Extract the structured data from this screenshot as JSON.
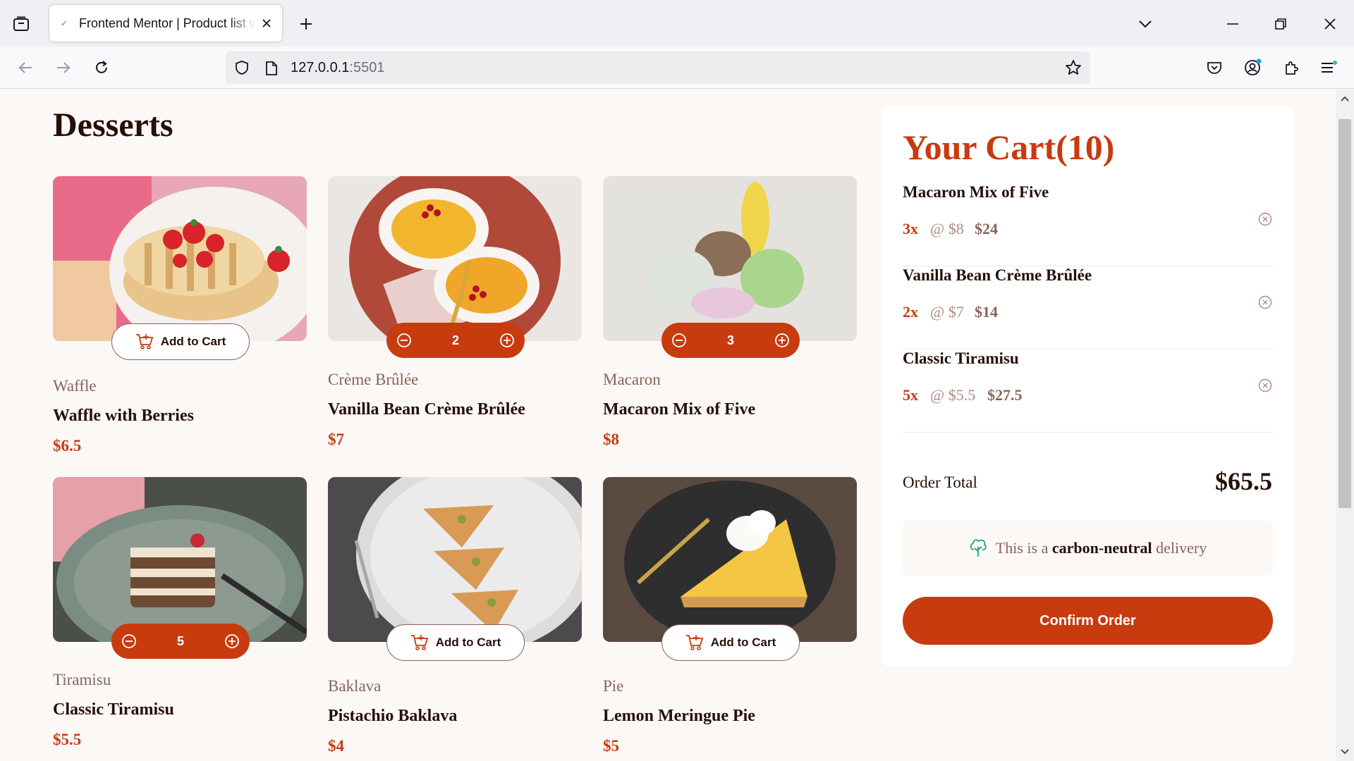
{
  "browser": {
    "tab_title": "Frontend Mentor | Product list with cart",
    "url_host": "127.0.0.1",
    "url_port": ":5501"
  },
  "page": {
    "title": "Desserts"
  },
  "products": [
    {
      "category": "Waffle",
      "name": "Waffle with Berries",
      "price": "$6.5",
      "quantity": null,
      "add_label": "Add to Cart"
    },
    {
      "category": "Crème Brûlée",
      "name": "Vanilla Bean Crème Brûlée",
      "price": "$7",
      "quantity": "2",
      "add_label": "Add to Cart"
    },
    {
      "category": "Macaron",
      "name": "Macaron Mix of Five",
      "price": "$8",
      "quantity": "3",
      "add_label": "Add to Cart"
    },
    {
      "category": "Tiramisu",
      "name": "Classic Tiramisu",
      "price": "$5.5",
      "quantity": "5",
      "add_label": "Add to Cart"
    },
    {
      "category": "Baklava",
      "name": "Pistachio Baklava",
      "price": "$4",
      "quantity": null,
      "add_label": "Add to Cart"
    },
    {
      "category": "Pie",
      "name": "Lemon Meringue Pie",
      "price": "$5",
      "quantity": null,
      "add_label": "Add to Cart"
    }
  ],
  "cart": {
    "title": "Your Cart(10)",
    "items": [
      {
        "name": "Macaron Mix of Five",
        "qty": "3x",
        "unit": "@ $8",
        "total": "$24"
      },
      {
        "name": "Vanilla Bean Crème Brûlée",
        "qty": "2x",
        "unit": "@ $7",
        "total": "$14"
      },
      {
        "name": "Classic Tiramisu",
        "qty": "5x",
        "unit": "@ $5.5",
        "total": "$27.5"
      }
    ],
    "order_total_label": "Order Total",
    "order_total": "$65.5",
    "carbon_prefix": "This is a",
    "carbon_bold": "carbon-neutral",
    "carbon_suffix": "delivery",
    "confirm_label": "Confirm Order"
  },
  "colors": {
    "accent": "#c73b0f",
    "text_dark": "#260f08",
    "text_muted": "#87635a",
    "background": "#fcf8f6",
    "carbon_icon": "#1ea575"
  },
  "icons": {
    "cart_add": "add-to-cart-icon",
    "decrement": "minus-circle-icon",
    "increment": "plus-circle-icon",
    "remove": "remove-item-icon",
    "carbon": "tree-icon"
  }
}
